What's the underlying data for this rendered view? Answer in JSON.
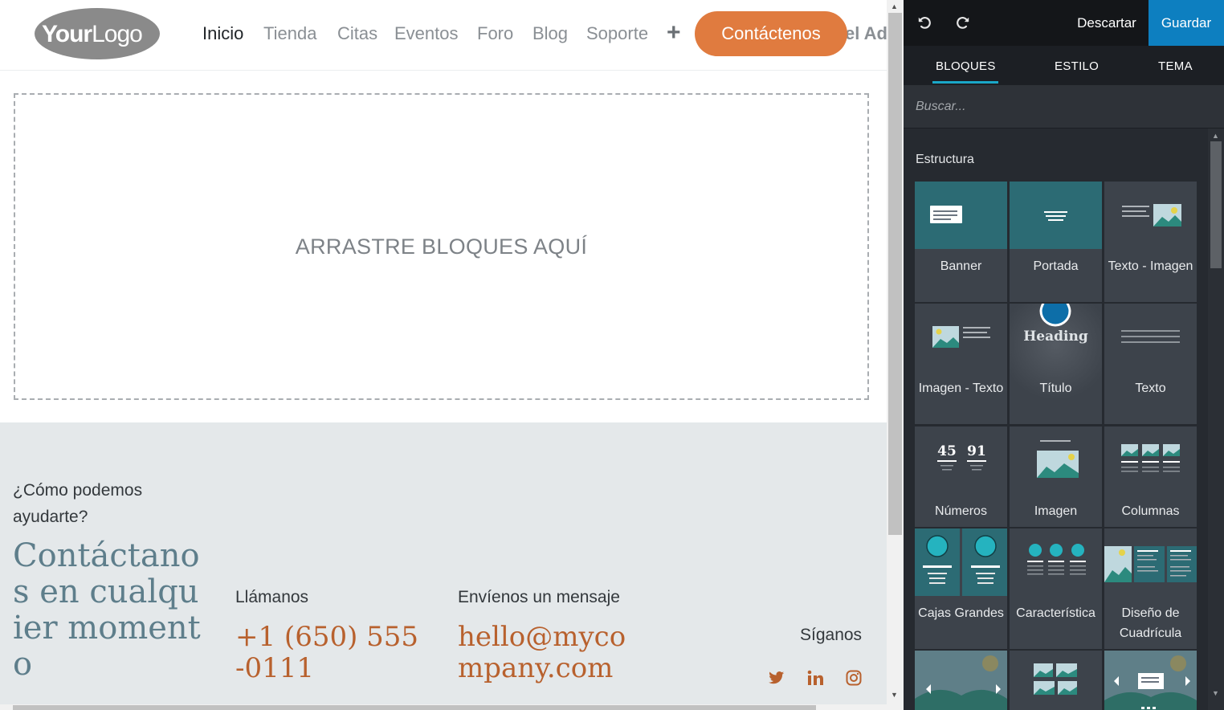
{
  "site": {
    "logo_text": "YourLogo",
    "nav": {
      "items": [
        "Inicio",
        "Tienda",
        "Citas",
        "Eventos",
        "Foro",
        "Blog",
        "Soporte"
      ],
      "cta": "Contáctenos",
      "overflow_text": "el Ad"
    },
    "dropzone_text": "ARRASTRE BLOQUES AQUÍ",
    "footer": {
      "help": "¿Cómo podemos ayudarte?",
      "headline": "Contáctanos en cualquier momento",
      "call_label": "Llámanos",
      "phone": "+1 (650) 555-0111",
      "message_label": "Envíenos un mensaje",
      "email": "hello@mycompany.com",
      "follow_label": "Síganos",
      "social": [
        "twitter-icon",
        "linkedin-icon",
        "instagram-icon"
      ]
    }
  },
  "editor": {
    "discard": "Descartar",
    "save": "Guardar",
    "tabs": [
      "BLOQUES",
      "ESTILO",
      "TEMA"
    ],
    "active_tab": "BLOQUES",
    "search_placeholder": "Buscar...",
    "section": "Estructura",
    "heading_thumb_text": "Heading",
    "numbers_thumb": [
      "45",
      "91"
    ],
    "blocks": [
      "Banner",
      "Portada",
      "Texto - Imagen",
      "Imagen - Texto",
      "Título",
      "Texto",
      "Números",
      "Imagen",
      "Columnas",
      "Cajas Grandes",
      "Característica",
      "Diseño de Cuadrícula"
    ]
  },
  "colors": {
    "cta": "#e07b3f",
    "save": "#0d7fc0",
    "tab_accent": "#1aa7c8",
    "link": "#b8612e",
    "headline": "#5e7e8b"
  }
}
